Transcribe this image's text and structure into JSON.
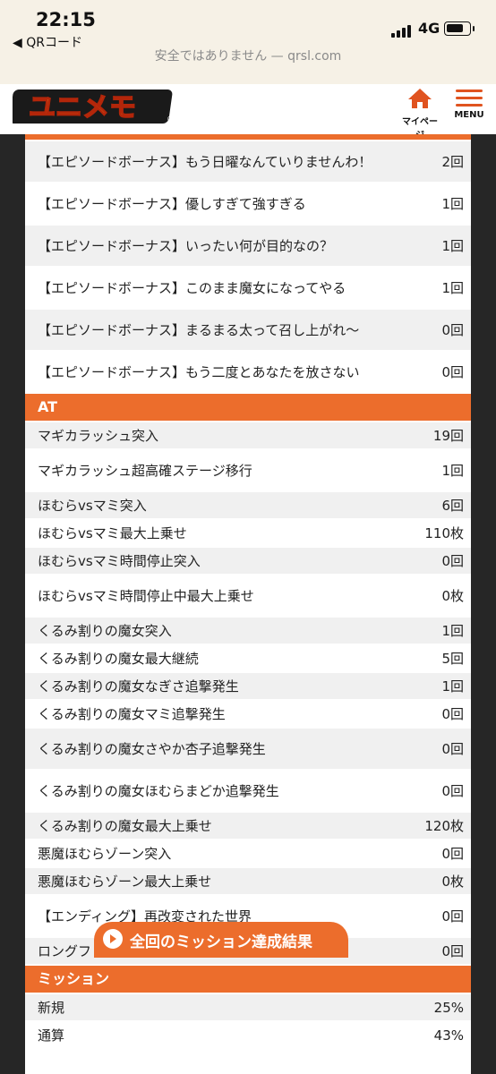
{
  "status": {
    "time": "22:15",
    "back_app": "◀ QRコード",
    "network": "4G",
    "url_text": "安全ではありません — qrsl.com"
  },
  "header": {
    "logo_text": "ユニメモ",
    "mypage_label": "マイページ",
    "menu_label": "MENU"
  },
  "colors": {
    "accent": "#ec6d2c",
    "row_alt": "#f0f0f0"
  },
  "bonus_rows": [
    {
      "name": "【エピソードボーナス】もう日曜なんていりませんわ！",
      "value": "2回"
    },
    {
      "name": "【エピソードボーナス】優しすぎて強すぎる",
      "value": "1回"
    },
    {
      "name": "【エピソードボーナス】いったい何が目的なの？",
      "value": "1回"
    },
    {
      "name": "【エピソードボーナス】このまま魔女になってやる",
      "value": "1回"
    },
    {
      "name": "【エピソードボーナス】まるまる太って召し上がれ〜",
      "value": "0回"
    },
    {
      "name": "【エピソードボーナス】もう二度とあなたを放さない",
      "value": "0回"
    }
  ],
  "at_section": {
    "title": "AT",
    "rows": [
      {
        "name": "マギカラッシュ突入",
        "value": "19回"
      },
      {
        "name": "マギカラッシュ超高確ステージ移行",
        "value": "1回"
      },
      {
        "name": "ほむらvsマミ突入",
        "value": "6回"
      },
      {
        "name": "ほむらvsマミ最大上乗せ",
        "value": "110枚"
      },
      {
        "name": "ほむらvsマミ時間停止突入",
        "value": "0回"
      },
      {
        "name": "ほむらvsマミ時間停止中最大上乗せ",
        "value": "0枚"
      },
      {
        "name": "くるみ割りの魔女突入",
        "value": "1回"
      },
      {
        "name": "くるみ割りの魔女最大継続",
        "value": "5回"
      },
      {
        "name": "くるみ割りの魔女なぎさ追撃発生",
        "value": "1回"
      },
      {
        "name": "くるみ割りの魔女マミ追撃発生",
        "value": "0回"
      },
      {
        "name": "くるみ割りの魔女さやか杏子追撃発生",
        "value": "0回"
      },
      {
        "name": "くるみ割りの魔女ほむらまどか追撃発生",
        "value": "0回"
      },
      {
        "name": "くるみ割りの魔女最大上乗せ",
        "value": "120枚"
      },
      {
        "name": "悪魔ほむらゾーン突入",
        "value": "0回"
      },
      {
        "name": "悪魔ほむらゾーン最大上乗せ",
        "value": "0枚"
      },
      {
        "name": "【エンディング】再改変された世界",
        "value": "0回"
      },
      {
        "name": "ロングフリーズ発生",
        "value": "0回"
      }
    ]
  },
  "mission_section": {
    "title": "ミッション",
    "rows": [
      {
        "name": "新規",
        "value": "25%"
      },
      {
        "name": "通算",
        "value": "43%"
      }
    ]
  },
  "cta_label": "全回のミッション達成結果"
}
